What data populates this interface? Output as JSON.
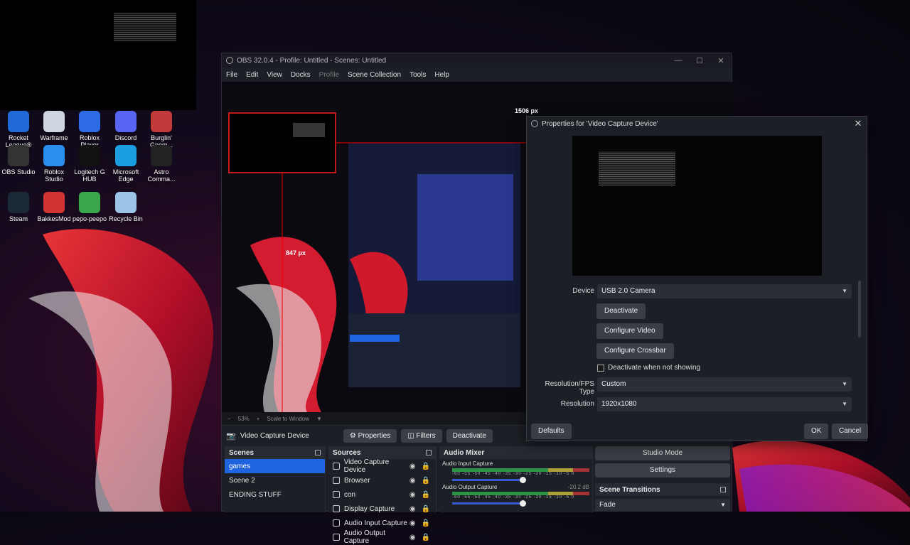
{
  "desktop": {
    "icons": [
      {
        "label": "Rocket League®",
        "color": "#1f6ad6"
      },
      {
        "label": "Warframe",
        "color": "#cfd6e0"
      },
      {
        "label": "Roblox Player",
        "color": "#2d6be4"
      },
      {
        "label": "Discord",
        "color": "#5865f2"
      },
      {
        "label": "Burglin' Gnom...",
        "color": "#c23a3a"
      },
      {
        "label": "OBS Studio",
        "color": "#333333"
      },
      {
        "label": "Roblox Studio",
        "color": "#2a8ef0"
      },
      {
        "label": "Logitech G HUB",
        "color": "#111111"
      },
      {
        "label": "Microsoft Edge",
        "color": "#1b9de2"
      },
      {
        "label": "Astro Comma...",
        "color": "#222222"
      },
      {
        "label": "Steam",
        "color": "#1b2838"
      },
      {
        "label": "BakkesMod",
        "color": "#d23434"
      },
      {
        "label": "pepo-peepo",
        "color": "#3aa64a"
      },
      {
        "label": "Recycle Bin",
        "color": "#9bc4e6"
      }
    ]
  },
  "obs": {
    "title": "OBS 32.0.4 - Profile: Untitled - Scenes: Untitled",
    "window_controls": [
      "—",
      "☐",
      "✕"
    ],
    "menu": [
      "File",
      "Edit",
      "View",
      "Docks",
      "Profile",
      "Scene Collection",
      "Tools",
      "Help"
    ],
    "preview": {
      "width_label": "1506 px",
      "height_label": "847 px"
    },
    "zoom": {
      "percent": "53%",
      "scale": "Scale to Window"
    },
    "context_bar": {
      "source": "Video Capture Device",
      "properties": "Properties",
      "filters": "Filters",
      "deactivate": "Deactivate"
    },
    "scenes": {
      "title": "Scenes",
      "items": [
        "games",
        "Scene 2",
        "ENDING STUFF"
      ],
      "selected": 0
    },
    "sources": {
      "title": "Sources",
      "items": [
        "Video Capture Device",
        "Browser",
        "con",
        "Display Capture",
        "Audio Input Capture",
        "Audio Output Capture"
      ]
    },
    "mixer": {
      "title": "Audio Mixer",
      "tracks": [
        {
          "name": "Audio Input Capture",
          "db": ""
        },
        {
          "name": "Audio Output Capture",
          "db": "-20.2 dB"
        }
      ],
      "scale": "-60 -55 -50 -45 -40 -35 -30 -25 -20 -15 -10 -5 0"
    },
    "controls": {
      "studio_mode": "Studio Mode",
      "settings": "Settings"
    },
    "transitions": {
      "title": "Scene Transitions",
      "value": "Fade"
    }
  },
  "properties": {
    "title": "Properties for 'Video Capture Device'",
    "device_label": "Device",
    "device_value": "USB 2.0 Camera",
    "deactivate": "Deactivate",
    "configure_video": "Configure Video",
    "configure_crossbar": "Configure Crossbar",
    "deactivate_when_not_showing": "Deactivate when not showing",
    "res_type_label": "Resolution/FPS Type",
    "res_type_value": "Custom",
    "resolution_label": "Resolution",
    "resolution_value": "1920x1080",
    "defaults": "Defaults",
    "ok": "OK",
    "cancel": "Cancel"
  }
}
